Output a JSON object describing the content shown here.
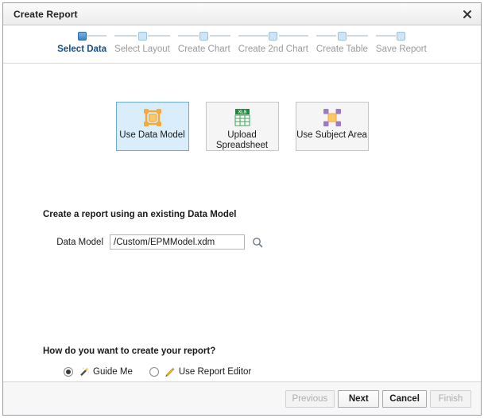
{
  "window": {
    "title": "Create Report",
    "close_label": "×"
  },
  "train": {
    "steps": [
      {
        "label": "Select Data",
        "active": true
      },
      {
        "label": "Select Layout",
        "active": false
      },
      {
        "label": "Create Chart",
        "active": false
      },
      {
        "label": "Create 2nd Chart",
        "active": false
      },
      {
        "label": "Create Table",
        "active": false
      },
      {
        "label": "Save Report",
        "active": false
      }
    ]
  },
  "tiles": [
    {
      "label": "Use Data Model",
      "icon": "data-model-icon",
      "selected": true
    },
    {
      "label": "Upload Spreadsheet",
      "icon": "spreadsheet-xls-icon",
      "selected": false
    },
    {
      "label": "Use Subject Area",
      "icon": "subject-area-icon",
      "selected": false
    }
  ],
  "data_model": {
    "section_title": "Create a report using an existing Data Model",
    "field_label": "Data Model",
    "field_value": "/Custom/EPMModel.xdm",
    "field_placeholder": "",
    "search_icon": "search-icon"
  },
  "report_mode": {
    "question": "How do you want to create your report?",
    "options": [
      {
        "label": "Guide Me",
        "icon": "magic-wand-icon",
        "selected": true
      },
      {
        "label": "Use Report Editor",
        "icon": "pencil-icon",
        "selected": false
      }
    ]
  },
  "footer": {
    "buttons": [
      {
        "label": "Previous",
        "enabled": false
      },
      {
        "label": "Next",
        "enabled": true
      },
      {
        "label": "Cancel",
        "enabled": true
      },
      {
        "label": "Finish",
        "enabled": false
      }
    ]
  },
  "colors": {
    "accent": "#13518f",
    "selected_tile_bg": "#d9edfa",
    "selected_tile_border": "#6aa9d8",
    "step_inactive": "#cfe4f5",
    "orange": "#f5a623",
    "green": "#1f8a3b",
    "purple": "#8f6fb5"
  }
}
